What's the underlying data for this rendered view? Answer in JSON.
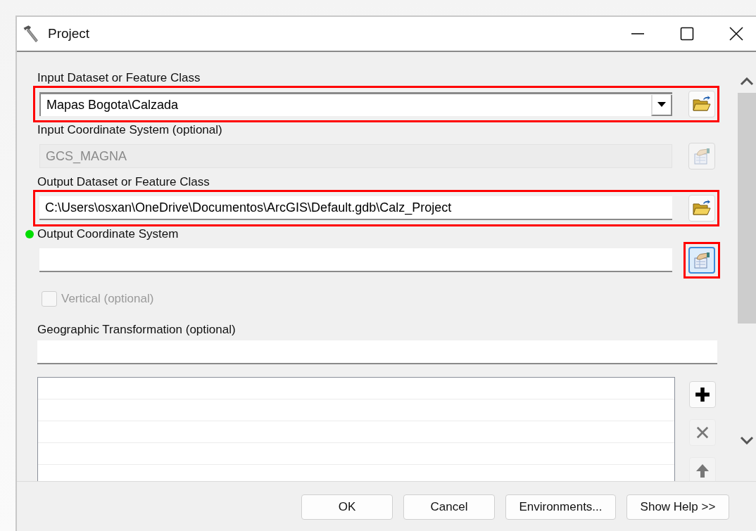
{
  "window": {
    "title": "Project"
  },
  "parameters": [
    {
      "kind": "combo",
      "label": "Input Dataset or Feature Class",
      "value": "Mapas Bogota\\Calzada",
      "required": false,
      "disabled": false,
      "highlighted": true,
      "button": {
        "kind": "folder",
        "highlighted": false
      }
    },
    {
      "kind": "text",
      "label": "Input Coordinate System (optional)",
      "value": "GCS_MAGNA",
      "required": false,
      "disabled": true,
      "highlighted": false,
      "button": {
        "kind": "properties",
        "highlighted": false
      }
    },
    {
      "kind": "text",
      "label": "Output Dataset or Feature Class",
      "value": "C:\\Users\\osxan\\OneDrive\\Documentos\\ArcGIS\\Default.gdb\\Calz_Project",
      "required": false,
      "disabled": false,
      "highlighted": true,
      "button": {
        "kind": "folder",
        "highlighted": false
      }
    },
    {
      "kind": "text",
      "label": "Output Coordinate System",
      "required": true,
      "disabled": false,
      "highlighted": false,
      "button": {
        "kind": "properties",
        "highlighted": true
      }
    },
    {
      "kind": "checkbox",
      "label": "Vertical (optional)",
      "checked": false,
      "disabled": true
    },
    {
      "kind": "list",
      "label": "Geographic Transformation (optional)"
    }
  ],
  "buttons": [
    "OK",
    "Cancel",
    "Environments...",
    "Show Help >>"
  ]
}
